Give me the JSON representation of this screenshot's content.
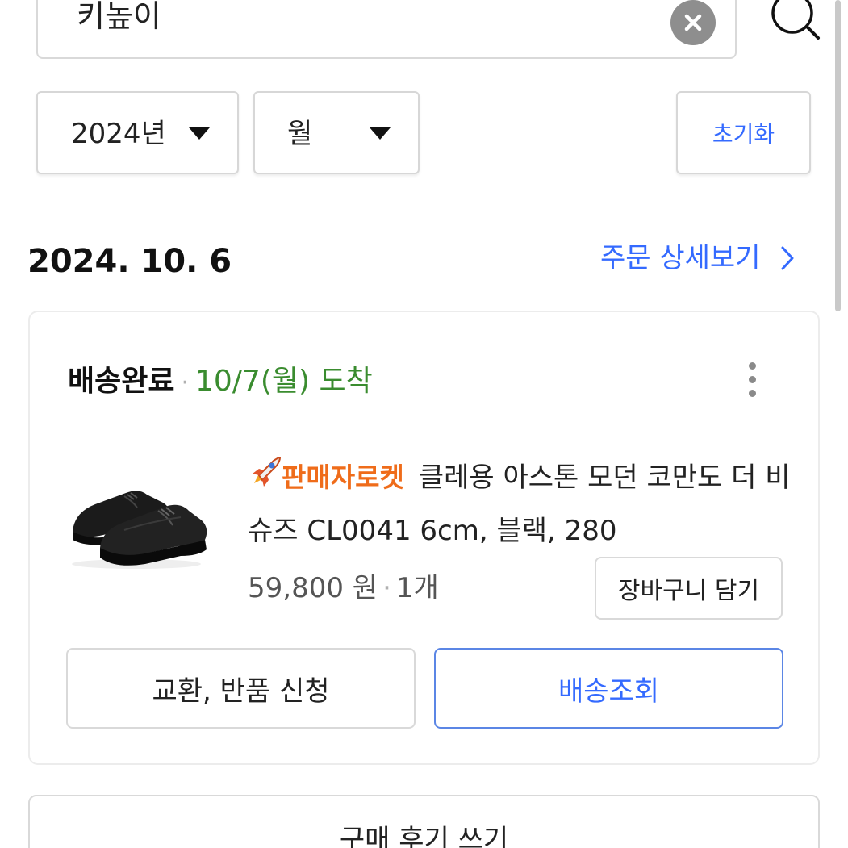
{
  "search": {
    "query": "키높이",
    "clear_icon": "close-icon",
    "search_icon": "search-icon"
  },
  "filters": {
    "year": "2024년",
    "month": "월",
    "reset_label": "초기화"
  },
  "order": {
    "date": "2024. 10. 6",
    "detail_link": "주문 상세보기",
    "status": "배송완료",
    "status_separator": "·",
    "arrival": "10/7(월) 도착",
    "product": {
      "badge": "판매자로켓",
      "badge_icon": "rocket-icon",
      "name": "클레용 아스톤 모던 코만도 더 비슈즈 CL0041 6cm, 블랙, 280",
      "price": "59,800 원",
      "quantity": "1개",
      "image": "black-leather-shoes-image"
    },
    "cart_button": "장바구니 담기",
    "exchange_button": "교환, 반품 신청",
    "tracking_button": "배송조회"
  },
  "review_button": "구매 후기 쓰기",
  "colors": {
    "accent_blue": "#346aff",
    "arrival_green": "#3a8c2f",
    "rocket_orange": "#ef6c1a"
  }
}
